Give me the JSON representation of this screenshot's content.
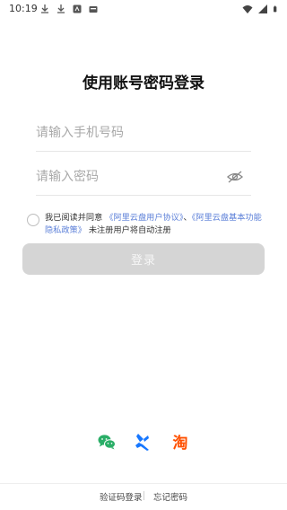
{
  "status_bar": {
    "time": "10:19",
    "left_icons": [
      "download-icon",
      "download-icon",
      "badge-icon",
      "box-icon"
    ],
    "right_icons": [
      "wifi-icon",
      "signal-icon",
      "battery-icon"
    ]
  },
  "page": {
    "title": "使用账号密码登录"
  },
  "form": {
    "phone_placeholder": "请输入手机号码",
    "password_placeholder": "请输入密码",
    "password_visibility_icon": "eye-off-icon"
  },
  "agreement": {
    "prefix": "我已阅读并同意",
    "link1": "《阿里云盘用户协议》",
    "separator": "、",
    "link2": "《阿里云盘基本功能隐私政策》",
    "suffix": "未注册用户将自动注册",
    "link_color": "#5b7fd8"
  },
  "login_button": {
    "label": "登录",
    "bg_color": "#d5d5d5"
  },
  "third_party": [
    {
      "name": "wechat",
      "icon": "wechat-icon",
      "color": "#2aae67"
    },
    {
      "name": "alipay",
      "icon": "alipay-icon",
      "color": "#1677ff"
    },
    {
      "name": "taobao",
      "icon": "taobao-icon",
      "color": "#ff5000"
    }
  ],
  "footer": {
    "code_login": "验证码登录",
    "forgot_password": "忘记密码"
  }
}
